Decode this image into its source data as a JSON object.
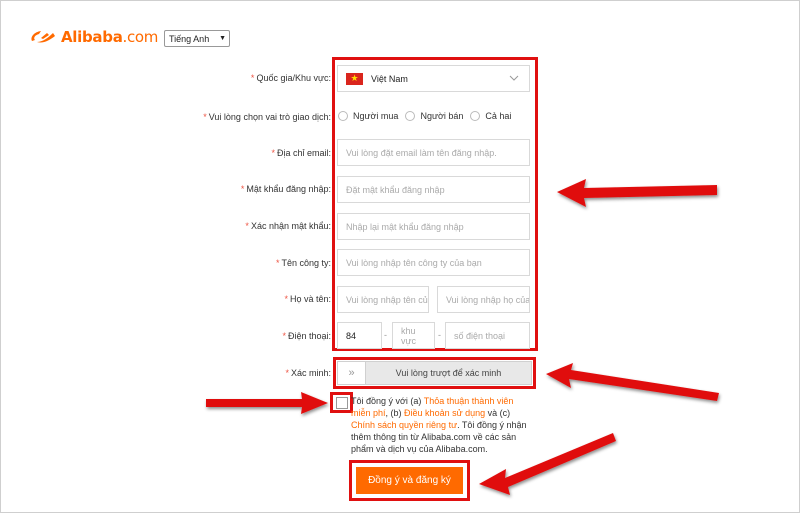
{
  "header": {
    "logo_text": "Alibaba",
    "logo_suffix": ".com",
    "language": "Tiếng Anh"
  },
  "form": {
    "country": {
      "label": "Quốc gia/Khu vực:",
      "value": "Việt Nam"
    },
    "role": {
      "label": "Vui lòng chọn vai trò giao dịch:",
      "options": [
        "Người mua",
        "Người bán",
        "Cả hai"
      ]
    },
    "email": {
      "label": "Địa chỉ email:",
      "placeholder": "Vui lòng đặt email làm tên đăng nhập."
    },
    "password": {
      "label": "Mật khẩu đăng nhập:",
      "placeholder": "Đặt mật khẩu đăng nhập"
    },
    "confirm": {
      "label": "Xác nhận mật khẩu:",
      "placeholder": "Nhập lại mật khẩu đăng nhập"
    },
    "company": {
      "label": "Tên công ty:",
      "placeholder": "Vui lòng nhập tên công ty của bạn"
    },
    "name": {
      "label": "Họ và tên:",
      "first_placeholder": "Vui lòng nhập tên củ",
      "last_placeholder": "Vui lòng nhập họ của"
    },
    "phone": {
      "label": "Điện thoại:",
      "code": "84",
      "area_placeholder": "khu vực",
      "number_placeholder": "số điện thoại",
      "sep": "-"
    },
    "verify": {
      "label": "Xác minh:",
      "slider_text": "Vui lòng trượt để xác minh",
      "handle": "»"
    },
    "agreement": {
      "part1": "Tôi đồng ý với (a) ",
      "link1": "Thỏa thuận thành viên miễn phí",
      "part2": ", (b) ",
      "link2": "Điều khoản sử dụng",
      "part3": " và (c) ",
      "link3": "Chính sách quyền riêng tư",
      "part4": ". Tôi đồng ý nhận thêm thông tin từ Alibaba.com về các sản phẩm và dịch vụ của Alibaba.com."
    },
    "submit_label": "Đồng ý và đăng ký",
    "required_mark": "*"
  },
  "colors": {
    "brand": "#ff6a00",
    "highlight": "#e01010"
  }
}
